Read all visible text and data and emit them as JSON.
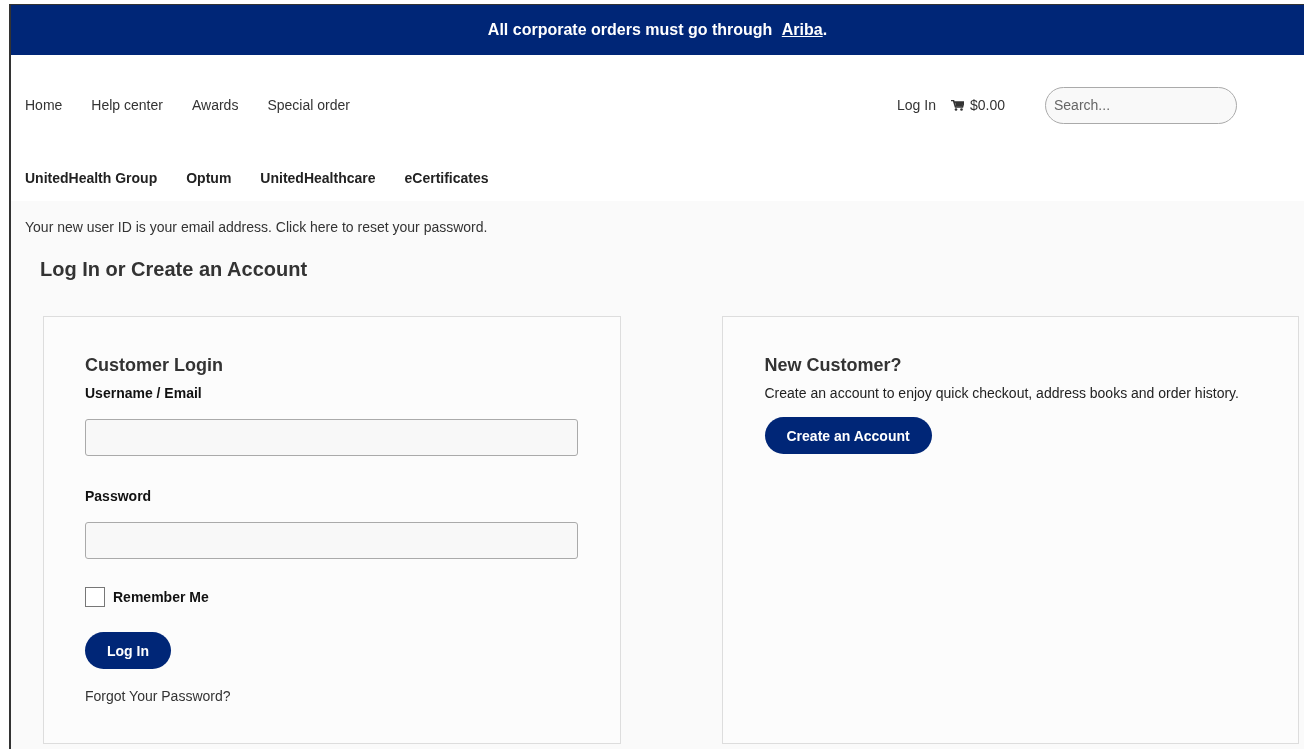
{
  "banner": {
    "text": "All corporate orders must go through",
    "link": "Ariba",
    "suffix": "."
  },
  "nav": {
    "items": [
      "Home",
      "Help center",
      "Awards",
      "Special order"
    ],
    "login": "Log In",
    "cart_total": "$0.00",
    "search": {
      "placeholder": "Search..."
    }
  },
  "brands": [
    "UnitedHealth Group",
    "Optum",
    "UnitedHealthcare",
    "eCertificates"
  ],
  "notice": "Your new user ID is your email address. Click here to reset your password.",
  "heading": "Log In or Create an Account",
  "login": {
    "title": "Customer Login",
    "fields": [
      {
        "label": "Username / Email"
      },
      {
        "label": "Password"
      }
    ],
    "remember": {
      "label": "Remember Me",
      "checked": false
    },
    "button": "Log In",
    "forgot": "Forgot Your Password?"
  },
  "new_customer": {
    "title": "New Customer?",
    "text": "Create an account to enjoy quick checkout, address books and order history.",
    "button": "Create an Account"
  }
}
